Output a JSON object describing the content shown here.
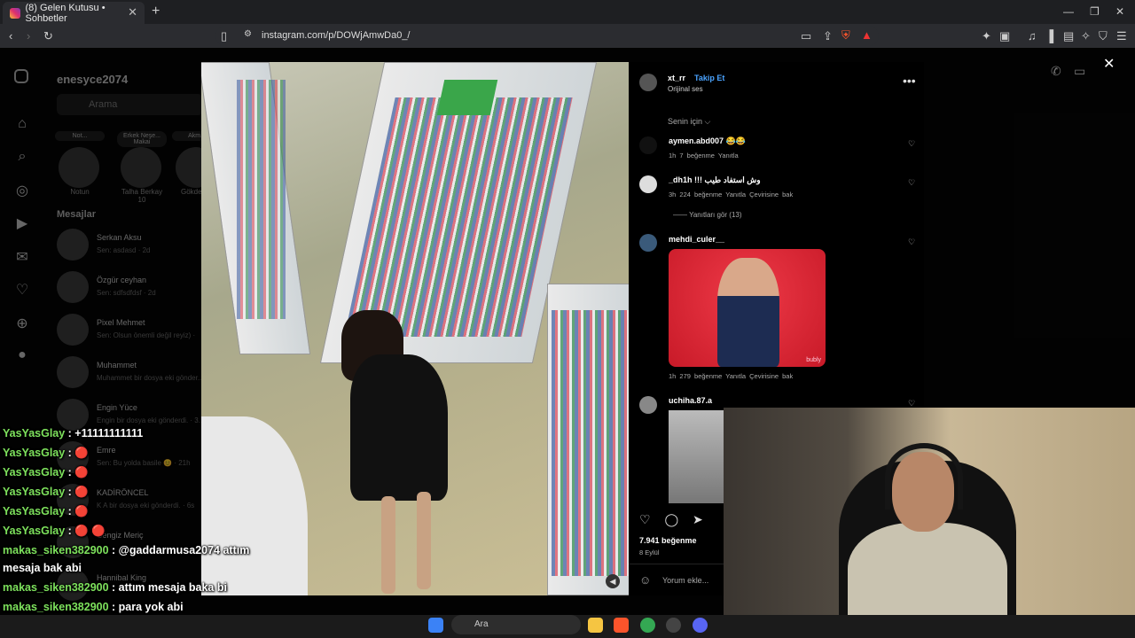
{
  "browser": {
    "tab_title": "(8) Gelen Kutusu • Sohbetler",
    "url": "instagram.com/p/DOWjAmwDa0_/"
  },
  "dm": {
    "username": "enesyce2074",
    "search_placeholder": "Arama",
    "stories": [
      {
        "note": "Not...",
        "name": "Notun"
      },
      {
        "note": "Erkek Neşe... Makai",
        "name": "Talha Berkay 10"
      },
      {
        "note": "Akm...",
        "name": "GökdeN..."
      }
    ],
    "messages_title": "Mesajlar",
    "messages": [
      {
        "name": "Serkan Aksu",
        "preview": "Sen: asdasd · 2d"
      },
      {
        "name": "Özgür ceyhan",
        "preview": "Sen: sdfsdfdsf · 2d"
      },
      {
        "name": "Pixel Mehmet",
        "preview": "Sen: Olsun önemli değil reyiz) ·"
      },
      {
        "name": "Muhammet",
        "preview": "Muhammet bir dosya eki gönder..."
      },
      {
        "name": "Engin Yüce",
        "preview": "Engin bir dosya eki gönderdi. · 3..."
      },
      {
        "name": "Emre",
        "preview": "Sen: Bu yolda basile 😊 · 21h"
      },
      {
        "name": "KADİRÖNCEL",
        "preview": "K A bir dosya eki gönderdi. · 6s"
      },
      {
        "name": "Cengiz Meriç",
        "preview": ""
      },
      {
        "name": "Hannibal King",
        "preview": ""
      }
    ]
  },
  "post": {
    "author": "xt_rr",
    "follow": "Takip Et",
    "audio": "Orijinal ses",
    "sort": "Senin için ⌵",
    "comments": [
      {
        "user": "aymen.abd007 😂😂",
        "meta": "1h   7 beğenme   Yanıtla"
      },
      {
        "user": "_dh1h !!! وش استفاد طيب",
        "meta": "3h   224 beğenme   Yanıtla   Çevirisine bak"
      },
      {
        "user": "mehdi_culer__",
        "meta": "1h   279 beğenme   Yanıtla   Çevirisine bak"
      },
      {
        "user": "uchiha.87.a",
        "meta": ""
      }
    ],
    "view_replies": "Yanıtları gör (13)",
    "gif_tag": "bubly",
    "likes": "7.941 beğenme",
    "date": "8 Eylül",
    "add_comment_placeholder": "Yorum ekle..."
  },
  "chat": [
    {
      "user": "YasYasGlay",
      "text": " : +11111111111"
    },
    {
      "user": "YasYasGlay",
      "text": " : 🔴"
    },
    {
      "user": "YasYasGlay",
      "text": " : 🔴"
    },
    {
      "user": "YasYasGlay",
      "text": " : 🔴"
    },
    {
      "user": "YasYasGlay",
      "text": " : 🔴"
    },
    {
      "user": "YasYasGlay",
      "text": " : 🔴 🔴"
    },
    {
      "user": "makas_siken382900",
      "text": " : @gaddarmusa2074 attım"
    },
    {
      "user": "",
      "text": "mesaja bak abi"
    },
    {
      "user": "makas_siken382900",
      "text": " : attım mesaja baka bi"
    },
    {
      "user": "makas_siken382900",
      "text": " : para yok abi"
    }
  ],
  "taskbar": {
    "search_label": "Ara"
  },
  "icons": {
    "close": "close-icon",
    "heart": "heart-icon",
    "comment": "comment-icon",
    "share": "share-icon",
    "more": "more-icon",
    "volume": "volume-icon"
  }
}
